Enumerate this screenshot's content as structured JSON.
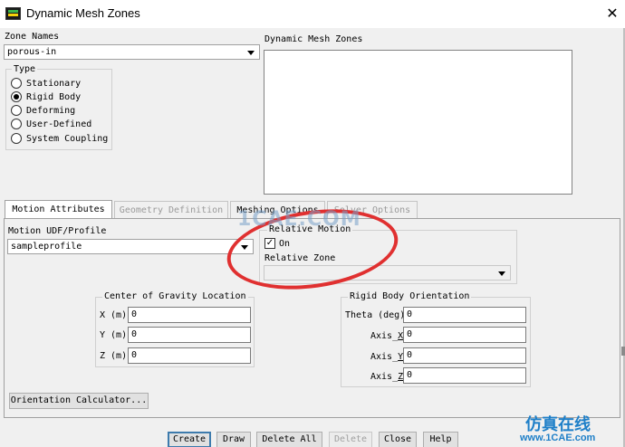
{
  "window": {
    "title": "Dynamic Mesh Zones",
    "close_glyph": "✕",
    "icon": "fluent-app-icon"
  },
  "zone_names": {
    "label": "Zone Names",
    "value": "porous-in"
  },
  "type_group": {
    "title": "Type",
    "options": [
      {
        "label": "Stationary",
        "selected": false
      },
      {
        "label": "Rigid Body",
        "selected": true
      },
      {
        "label": "Deforming",
        "selected": false
      },
      {
        "label": "User-Defined",
        "selected": false
      },
      {
        "label": "System Coupling",
        "selected": false
      }
    ]
  },
  "dynamic_mesh_zones": {
    "label": "Dynamic Mesh Zones",
    "items": []
  },
  "tabs": [
    {
      "label": "Motion Attributes",
      "active": true,
      "enabled": true
    },
    {
      "label": "Geometry Definition",
      "active": false,
      "enabled": false
    },
    {
      "label": "Meshing Options",
      "active": false,
      "enabled": true
    },
    {
      "label": "Solver Options",
      "active": false,
      "enabled": false
    }
  ],
  "motion": {
    "udf_label": "Motion UDF/Profile",
    "udf_value": "sampleprofile",
    "relative_motion_title": "Relative Motion",
    "on_label": "On",
    "on_checked": true,
    "relative_zone_label": "Relative Zone",
    "relative_zone_value": ""
  },
  "center_of_gravity": {
    "title": "Center of Gravity Location",
    "fields": [
      {
        "label": "X (m)",
        "value": "0"
      },
      {
        "label": "Y (m)",
        "value": "0"
      },
      {
        "label": "Z (m)",
        "value": "0"
      }
    ]
  },
  "rigid_body_orientation": {
    "title": "Rigid Body Orientation",
    "theta_label": "Theta (deg)",
    "theta_value": "0",
    "axis_x_label": "Axis_X",
    "axis_x_value": "0",
    "axis_y_label": "Axis_Y",
    "axis_y_value": "0",
    "axis_z_label": "Axis_Z",
    "axis_z_value": "0"
  },
  "orientation_calculator_label": "Orientation Calculator...",
  "buttons": {
    "create": "Create",
    "draw": "Draw",
    "delete_all": "Delete All",
    "delete": "Delete",
    "close": "Close",
    "help": "Help"
  },
  "watermark": {
    "text": "1CAE.COM",
    "brand_cn": "仿真在线",
    "brand_url": "www.1CAE.com"
  }
}
